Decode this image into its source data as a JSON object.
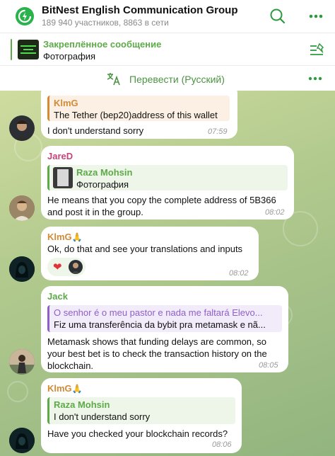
{
  "header": {
    "title": "BitNest English Communication Group",
    "subtitle": "189 940 участников, 8863 в сети",
    "icons": [
      "bitnest-logo-icon",
      "search-icon",
      "more-icon"
    ],
    "accent": "#2bb24c"
  },
  "pinned": {
    "title": "Закреплённое сообщение",
    "text": "Фотография",
    "accent": "#5caa48"
  },
  "translate": {
    "label": "Перевести (Русский)",
    "accent": "#4b9441"
  },
  "messages": [
    {
      "quote_name": "KlmG",
      "quote_text": "The Tether (bep20)address of this wallet",
      "text": "I don't understand sorry",
      "time": "07:59"
    },
    {
      "sender": "JareD",
      "quote_name": "Raza Mohsin",
      "quote_text": "Фотография",
      "text_line1": "He means that you copy the complete address of 5B366",
      "text_line2": "and post it in the group.",
      "time": "08:02"
    },
    {
      "sender": "KlmG",
      "sender_emoji": "🙏",
      "text": "Ok, do that and see your translations and inputs",
      "reaction": "❤",
      "time": "08:02"
    },
    {
      "sender": "Jack",
      "quote_name": "O senhor é o meu pastor e nada me faltará Elevo...",
      "quote_text": "Fiz uma transferência da bybit pra metamask e nã...",
      "text_line1": "Metamask shows that funding delays are common, so",
      "text_line2": "your best bet is to check the transaction history on the",
      "text_line3": "blockchain.",
      "time": "08:05"
    },
    {
      "sender": "KlmG",
      "sender_emoji": "🙏",
      "quote_name": "Raza Mohsin",
      "quote_text": "I don't understand sorry",
      "text": "Have you checked your blockchain records?",
      "time": "08:06"
    }
  ],
  "colors": {
    "name_orange": "#d58a34",
    "name_pink": "#c4457b",
    "name_green": "#5caa48",
    "name_purple": "#8f5fc9"
  }
}
